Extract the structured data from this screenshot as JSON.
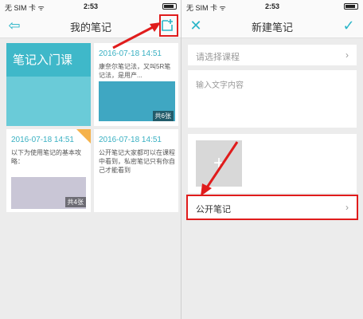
{
  "left_screen": {
    "status": {
      "carrier": "无 SIM 卡 ᯤ",
      "time": "2:53"
    },
    "nav": {
      "title": "我的笔记",
      "back_icon": "back-arrow-icon",
      "new_icon": "new-note-icon"
    },
    "cards": [
      {
        "title": "笔记入门课"
      },
      {
        "date": "2016-07-18 14:51",
        "text": "康奈尔笔记法，又叫5R笔记法，是用产...",
        "count": "共6张"
      },
      {
        "date": "2016-07-18 14:51",
        "text": "以下为使用笔记的基本攻略：",
        "count": "共4张"
      },
      {
        "date": "2016-07-18 14:51",
        "text": "公开笔记大家都可以在课程中看到，私密笔记只有你自己才能看到"
      }
    ]
  },
  "right_screen": {
    "status": {
      "carrier": "无 SIM 卡 ᯤ",
      "time": "2:53"
    },
    "nav": {
      "title": "新建笔记",
      "close_icon": "close-icon",
      "confirm_icon": "check-icon"
    },
    "course_select": {
      "label": "请选择课程",
      "arrow": "›"
    },
    "content_placeholder": "输入文字内容",
    "add_photo_icon": "plus-icon",
    "public_note": {
      "label": "公开笔记",
      "arrow": "›"
    }
  },
  "colors": {
    "accent": "#2ab5c8",
    "highlight": "#e01c1c"
  }
}
